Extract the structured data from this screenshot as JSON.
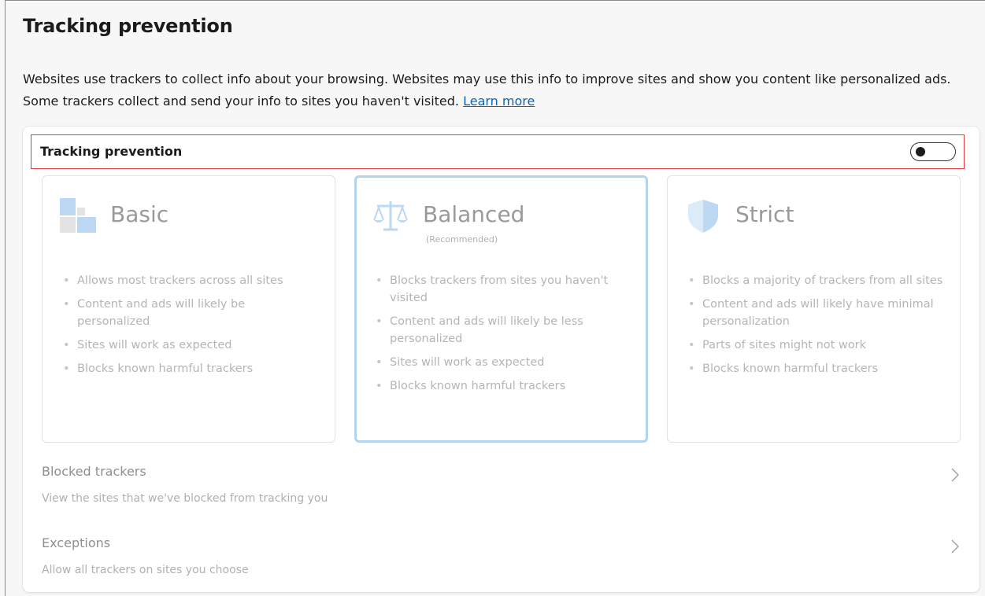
{
  "page": {
    "title": "Tracking prevention",
    "description": "Websites use trackers to collect info about your browsing. Websites may use this info to improve sites and show you content like personalized ads. Some trackers collect and send your info to sites you haven't visited.",
    "learn_more": "Learn more"
  },
  "tracking_prevention": {
    "label": "Tracking prevention",
    "toggle_on": false
  },
  "options": [
    {
      "title": "Basic",
      "subtitle": "",
      "icon": "basic-blocks-icon",
      "bullets": [
        "Allows most trackers across all sites",
        "Content and ads will likely be personalized",
        "Sites will work as expected",
        "Blocks known harmful trackers"
      ]
    },
    {
      "title": "Balanced",
      "subtitle": "(Recommended)",
      "icon": "scales-icon",
      "selected": true,
      "bullets": [
        "Blocks trackers from sites you haven't visited",
        "Content and ads will likely be less personalized",
        "Sites will work as expected",
        "Blocks known harmful trackers"
      ]
    },
    {
      "title": "Strict",
      "subtitle": "",
      "icon": "shield-icon",
      "bullets": [
        "Blocks a majority of trackers from all sites",
        "Content and ads will likely have minimal personalization",
        "Parts of sites might not work",
        "Blocks known harmful trackers"
      ]
    }
  ],
  "links": {
    "blocked_trackers": {
      "title": "Blocked trackers",
      "subtitle": "View the sites that we've blocked from tracking you"
    },
    "exceptions": {
      "title": "Exceptions",
      "subtitle": "Allow all trackers on sites you choose"
    }
  },
  "colors": {
    "link": "#0f63b5",
    "highlight_border": "#e03a3a",
    "selected_border": "#b4d3ec",
    "icon_blue": "#bcd8f2",
    "icon_gray": "#e3e3e3"
  }
}
